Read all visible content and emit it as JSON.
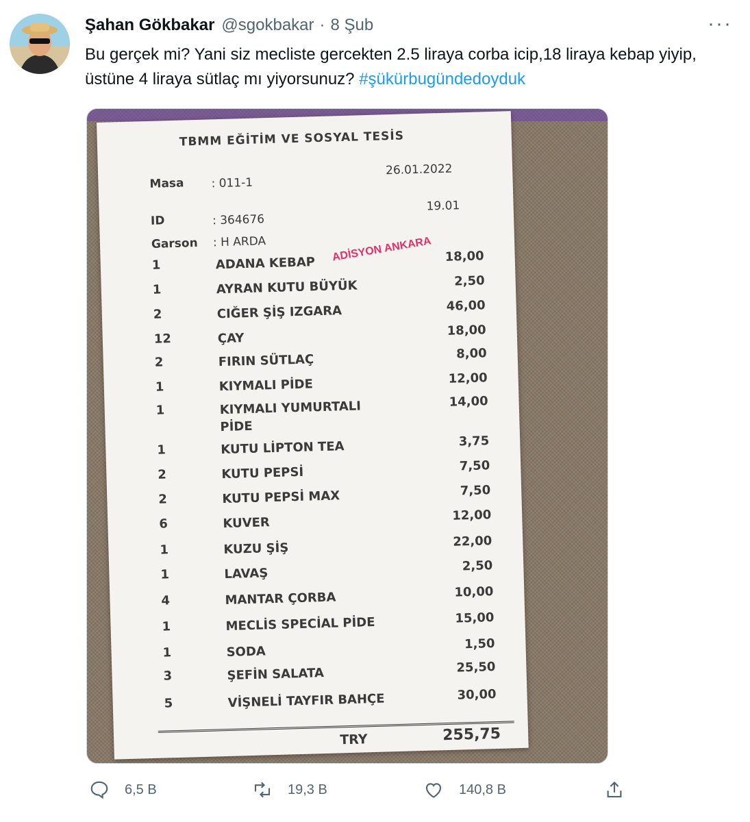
{
  "tweet": {
    "author_name": "Şahan Gökbakar",
    "author_handle": "@sgokbakar",
    "separator": "·",
    "date": "8 Şub",
    "more_label": "···",
    "text": "Bu gerçek mi? Yani siz mecliste gercekten 2.5 liraya corba icip,18 liraya kebap yiyip, üstüne 4 liraya sütlaç mı yiyorsunuz?",
    "hashtag": "#şükürbugündedoyduk"
  },
  "receipt": {
    "title": "TBMM EĞİTİM VE SOSYAL TESİS",
    "masa_label": "Masa",
    "masa_value": ": 011-1",
    "date": "26.01.2022",
    "id_label": "ID",
    "id_value": ": 364676",
    "time": "19.01",
    "garson_label": "Garson",
    "garson_value": ": H ARDA",
    "watermark": "ADİSYON ANKARA",
    "items": [
      {
        "qty": "1",
        "name": "ADANA KEBAP",
        "price": "18,00"
      },
      {
        "qty": "1",
        "name": "AYRAN KUTU BÜYÜK",
        "price": "2,50"
      },
      {
        "qty": "2",
        "name": "CIĞER ŞİŞ IZGARA",
        "price": "46,00"
      },
      {
        "qty": "12",
        "name": "ÇAY",
        "price": "18,00"
      },
      {
        "qty": "2",
        "name": "FIRIN SÜTLAÇ",
        "price": "8,00"
      },
      {
        "qty": "1",
        "name": "KIYMALI PİDE",
        "price": "12,00"
      },
      {
        "qty": "1",
        "name": "KIYMALI YUMURTALI PİDE",
        "price": "14,00"
      },
      {
        "qty": "1",
        "name": "KUTU LİPTON TEA",
        "price": "3,75"
      },
      {
        "qty": "2",
        "name": "KUTU PEPSİ",
        "price": "7,50"
      },
      {
        "qty": "2",
        "name": "KUTU PEPSİ MAX",
        "price": "7,50"
      },
      {
        "qty": "6",
        "name": "KUVER",
        "price": "12,00"
      },
      {
        "qty": "1",
        "name": "KUZU ŞİŞ",
        "price": "22,00"
      },
      {
        "qty": "1",
        "name": "LAVAŞ",
        "price": "2,50"
      },
      {
        "qty": "4",
        "name": "MANTAR ÇORBA",
        "price": "10,00"
      },
      {
        "qty": "1",
        "name": "MECLİS SPECİAL PİDE",
        "price": "15,00"
      },
      {
        "qty": "1",
        "name": "SODA",
        "price": "1,50"
      },
      {
        "qty": "3",
        "name": "ŞEFİN SALATA",
        "price": "25,50"
      },
      {
        "qty": "5",
        "name": "VİŞNELİ TAYFIR BAHÇE",
        "price": "30,00"
      }
    ],
    "total_label": "TRY",
    "total_value": "255,75"
  },
  "actions": {
    "reply": {
      "icon": "reply-icon",
      "count": "6,5 B"
    },
    "retweet": {
      "icon": "retweet-icon",
      "count": "19,3 B"
    },
    "like": {
      "icon": "heart-icon",
      "count": "140,8 B"
    },
    "share": {
      "icon": "share-icon"
    }
  },
  "colors": {
    "hashtag": "#1d9bf0",
    "secondary_text": "#536471",
    "watermark": "#e1306c"
  }
}
